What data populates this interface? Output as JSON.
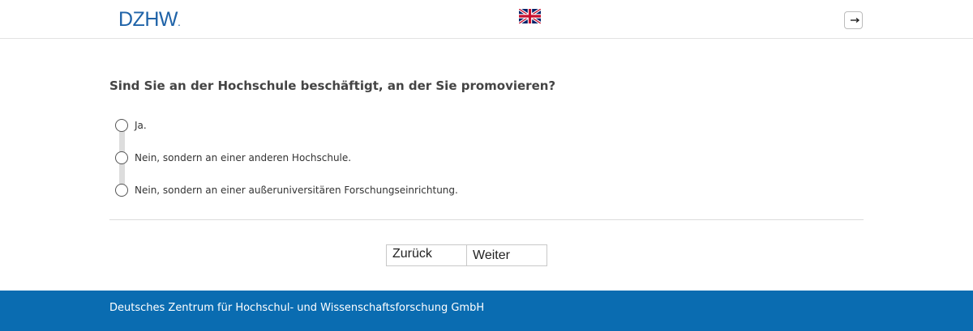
{
  "header": {
    "logo_text": "DZHW",
    "logo_dot": ".",
    "language_icon": "uk-flag-icon",
    "logout_icon": "logout-icon"
  },
  "question": {
    "text": "Sind Sie an der Hochschule beschäftigt, an der Sie promovieren?",
    "options": [
      {
        "label": "Ja."
      },
      {
        "label": "Nein, sondern an einer anderen Hochschule."
      },
      {
        "label": "Nein, sondern an einer außeruniversitären Forschungseinrichtung."
      }
    ]
  },
  "navigation": {
    "back_label": "Zurück",
    "next_label": "Weiter"
  },
  "footer": {
    "text": "Deutsches Zentrum für Hochschul- und Wissenschaftsforschung GmbH"
  },
  "colors": {
    "brand_blue": "#1f63a8",
    "footer_blue": "#0a6cb1"
  }
}
